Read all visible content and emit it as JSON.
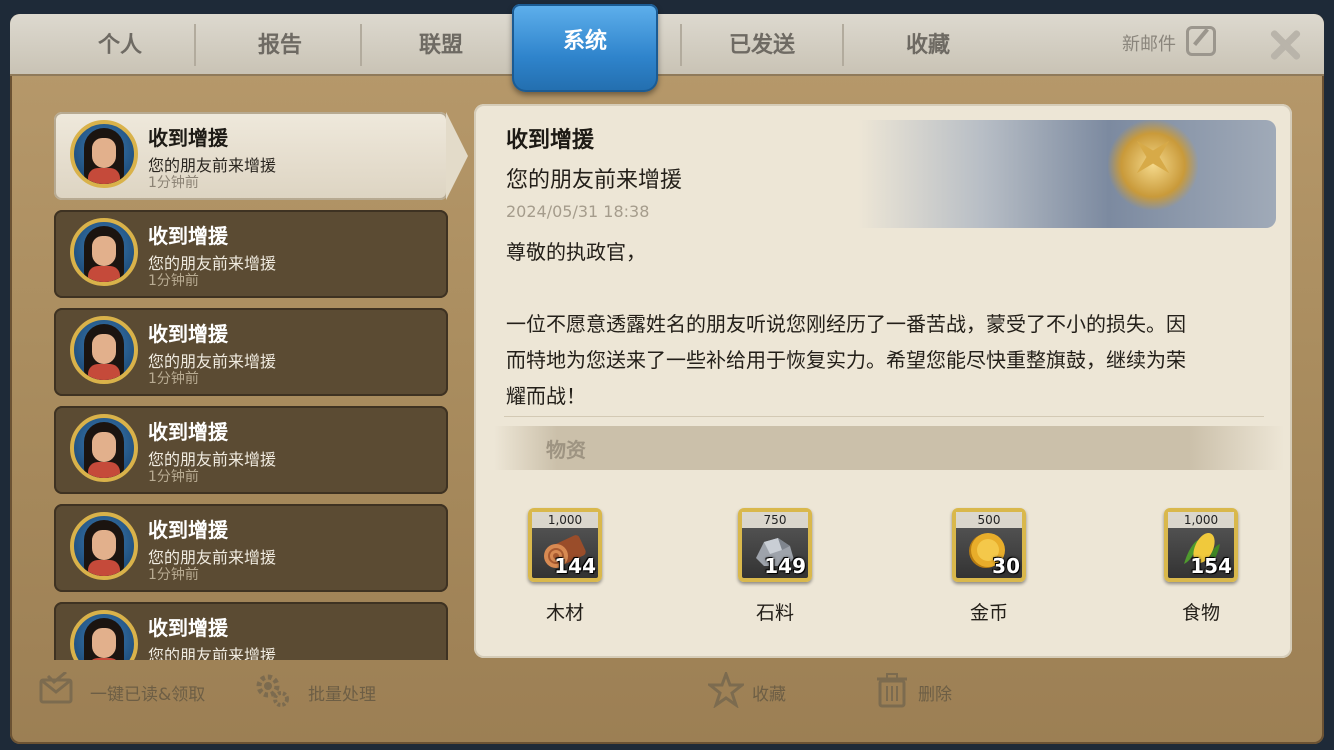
{
  "tabs": {
    "personal": "个人",
    "report": "报告",
    "alliance": "联盟",
    "system": "系统",
    "sent": "已发送",
    "favorites": "收藏"
  },
  "new_mail_label": "新邮件",
  "mails": [
    {
      "title": "收到增援",
      "subtitle": "您的朋友前来增援",
      "time": "1分钟前",
      "selected": true
    },
    {
      "title": "收到增援",
      "subtitle": "您的朋友前来增援",
      "time": "1分钟前"
    },
    {
      "title": "收到增援",
      "subtitle": "您的朋友前来增援",
      "time": "1分钟前"
    },
    {
      "title": "收到增援",
      "subtitle": "您的朋友前来增援",
      "time": "1分钟前"
    },
    {
      "title": "收到增援",
      "subtitle": "您的朋友前来增援",
      "time": "1分钟前"
    },
    {
      "title": "收到增援",
      "subtitle": "您的朋友前来增援",
      "time": ""
    }
  ],
  "detail": {
    "title": "收到增援",
    "subtitle": "您的朋友前来增援",
    "date": "2024/05/31 18:38",
    "greeting": "尊敬的执政官，",
    "body": "一位不愿意透露姓名的朋友听说您刚经历了一番苦战，蒙受了不小的损失。因\n而特地为您送来了一些补给用于恢复实力。希望您能尽快重整旗鼓，继续为荣\n耀而战！",
    "section_label": "物资",
    "resources": [
      {
        "name": "木材",
        "cap": "1,000",
        "count": "144",
        "icon": "wood-icon",
        "color": "#b5623a"
      },
      {
        "name": "石料",
        "cap": "750",
        "count": "149",
        "icon": "stone-icon",
        "color": "#a8adb5"
      },
      {
        "name": "金币",
        "cap": "500",
        "count": "30",
        "icon": "gold-coin-icon",
        "color": "#e1a624"
      },
      {
        "name": "食物",
        "cap": "1,000",
        "count": "154",
        "icon": "corn-icon",
        "color": "#e7c43a"
      }
    ]
  },
  "bottom": {
    "read_all": "一键已读&领取",
    "batch": "批量处理",
    "favorite": "收藏",
    "delete": "删除"
  }
}
